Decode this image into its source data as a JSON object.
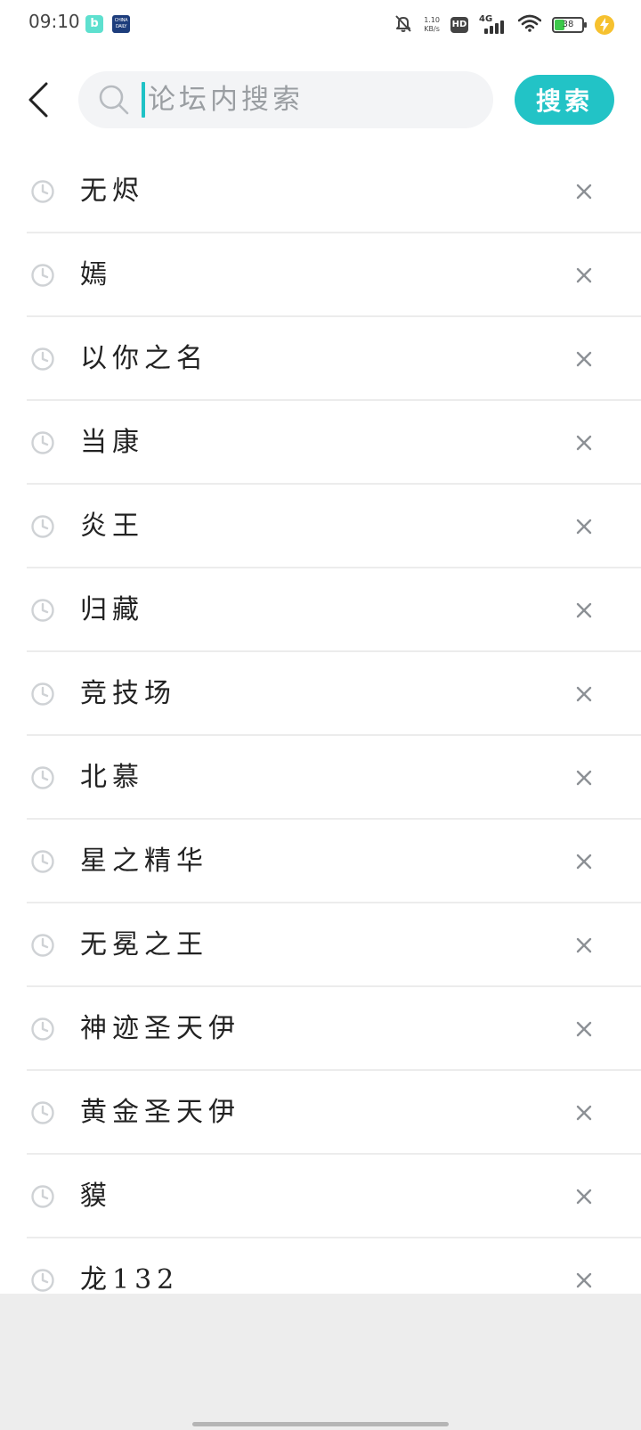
{
  "status_bar": {
    "time": "09:10",
    "app_icon_1": "b",
    "app_icon_2": "CHINA DAILY",
    "net_speed_value": "1.10",
    "net_speed_unit": "KB/s",
    "hd": "HD",
    "network": "4G",
    "battery_level": 38,
    "battery_text": "38"
  },
  "search": {
    "placeholder": "论坛内搜索",
    "value": "",
    "button_label": "搜索"
  },
  "history": [
    {
      "label": "无烬"
    },
    {
      "label": "嫣"
    },
    {
      "label": "以你之名"
    },
    {
      "label": "当康"
    },
    {
      "label": "炎王"
    },
    {
      "label": "归藏"
    },
    {
      "label": "竞技场"
    },
    {
      "label": "北慕"
    },
    {
      "label": "星之精华"
    },
    {
      "label": "无冕之王"
    },
    {
      "label": "神迹圣天伊"
    },
    {
      "label": "黄金圣天伊"
    },
    {
      "label": "貘"
    },
    {
      "label": "龙132"
    }
  ],
  "icons": {
    "back": "chevron-left-icon",
    "search": "search-icon",
    "history": "clock-icon",
    "remove": "close-icon"
  },
  "colors": {
    "accent": "#22c3c6",
    "search_bg": "#f3f4f6",
    "divider": "#ececec",
    "bottom_area": "#ededed",
    "battery_fill": "#3cc84a",
    "charge": "#f6c12f"
  }
}
